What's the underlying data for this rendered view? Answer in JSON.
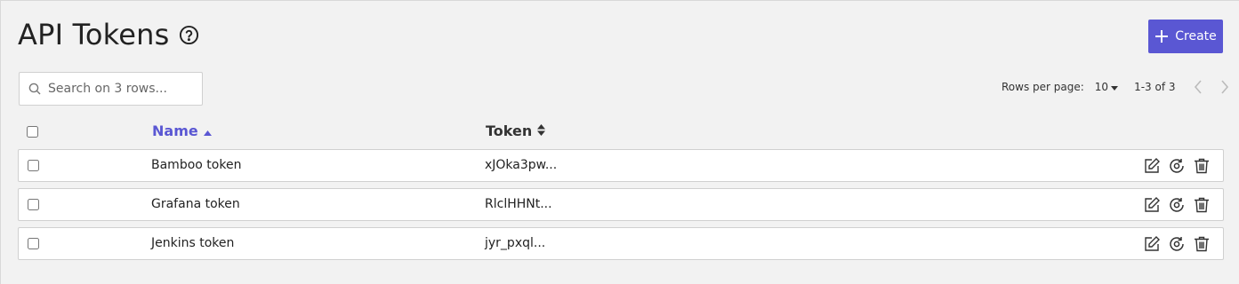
{
  "page": {
    "title": "API Tokens"
  },
  "toolbar": {
    "create_label": "Create"
  },
  "search": {
    "placeholder": "Search on 3 rows..."
  },
  "pagination": {
    "rows_per_page_label": "Rows per page:",
    "rows_per_page_value": "10",
    "range": "1-3 of 3"
  },
  "table": {
    "columns": [
      "Name",
      "Token"
    ],
    "rows": [
      {
        "name": "Bamboo token",
        "token": "xJOka3pw..."
      },
      {
        "name": "Grafana token",
        "token": "RlclHHNt..."
      },
      {
        "name": "Jenkins token",
        "token": "jyr_pxql..."
      }
    ]
  },
  "colors": {
    "accent": "#5a57d3",
    "background": "#f2f2f2",
    "row_border": "#d0d0d0"
  },
  "icons": [
    "help-icon",
    "plus-icon",
    "search-icon",
    "chevron-down-icon",
    "chevron-left-icon",
    "chevron-right-icon",
    "sort-asc-icon",
    "sort-icon",
    "edit-icon",
    "regenerate-icon",
    "trash-icon"
  ]
}
